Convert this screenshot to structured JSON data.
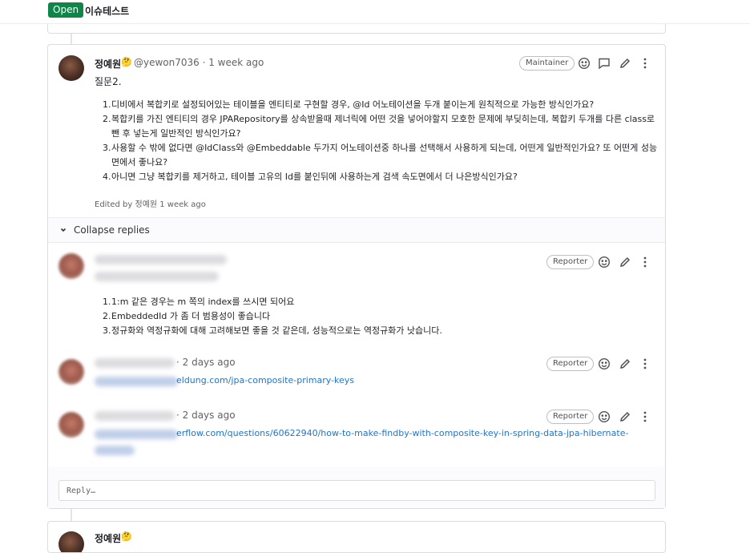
{
  "header": {
    "status": "Open",
    "title": "이슈테스트"
  },
  "comment": {
    "author_name": "정예원",
    "author_emoji": "🤔",
    "author_meta": "@yewon7036 · 1 week ago",
    "role": "Maintainer",
    "intro": "질문2.",
    "questions": [
      "디비에서 복합키로 설정되어있는 테이블을 엔티티로 구현할 경우, @Id 어노테이션을 두개 붙이는게 원칙적으로 가능한 방식인가요?",
      "복합키를 가진 엔티티의 경우 JPARepository를 상속받을때 제너릭에 어떤 것을 넣어야할지 모호한 문제에 부딪히는데, 복합키 두개를 다른 class로 뺀 후 넣는게 일반적인 방식인가요?",
      "사용할 수 밖에 없다면 @IdClass와 @Embeddable 두가지 어노테이션중 하나를 선택해서 사용하게 되는데, 어떤게 일반적인가요? 또 어떤게 성능면에서 좋나요?",
      "아니면 그냥 복합키를 제거하고, 테이블 고유의 Id를 붙인뒤에 사용하는게 검색 속도면에서 더 나은방식인가요?"
    ],
    "edited": "Edited by 정예원 1 week ago"
  },
  "replies": {
    "collapse_label": "Collapse replies",
    "items": [
      {
        "role": "Reporter",
        "answers": [
          "1:m 같은 경우는 m 쪽의 index를 쓰시면 되어요",
          "EmbeddedId 가 좀 더 범용성이 좋습니다",
          "정규화와 역정규화에 대해 고려해보면 좋을 것 같은데, 성능적으로는 역정규화가 낫습니다."
        ]
      },
      {
        "meta": "· 2 days ago",
        "role": "Reporter",
        "link_visible": "eldung.com/jpa-composite-primary-keys"
      },
      {
        "meta": "· 2 days ago",
        "role": "Reporter",
        "link_visible": "erflow.com/questions/60622940/how-to-make-findby-with-composite-key-in-spring-data-jpa-hibernate-"
      }
    ],
    "reply_placeholder": "Reply…"
  },
  "next_comment": {
    "author_name": "정예원",
    "author_emoji": "🤔"
  }
}
